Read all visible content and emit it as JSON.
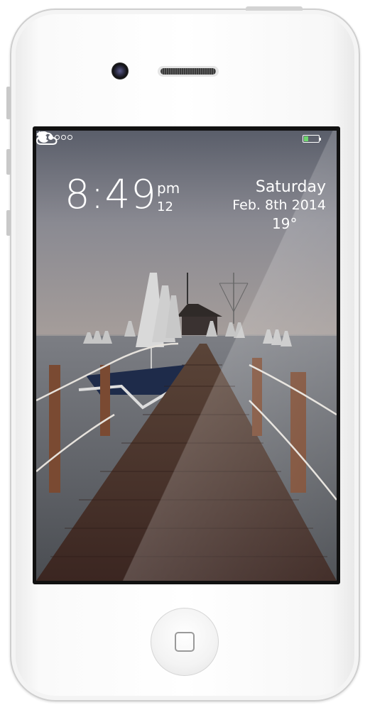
{
  "status_bar": {
    "signal_dots": [
      true,
      true,
      false,
      false,
      false
    ],
    "carrier_icon": "pacman-icon",
    "wifi_icon": "wifi-icon",
    "battery_level": 0.3,
    "battery_color": "#6dd46d",
    "charging_icon": "bolt-icon"
  },
  "clock": {
    "time": "8:49",
    "ampm": "pm",
    "seconds": "12"
  },
  "date": {
    "day": "Saturday",
    "date": "Feb. 8th 2014"
  },
  "weather": {
    "temperature": "19°",
    "icon": "cloud-icon"
  },
  "wallpaper": {
    "subject": "pier-icon"
  },
  "device": {
    "home_button_icon": "home-square-icon"
  }
}
